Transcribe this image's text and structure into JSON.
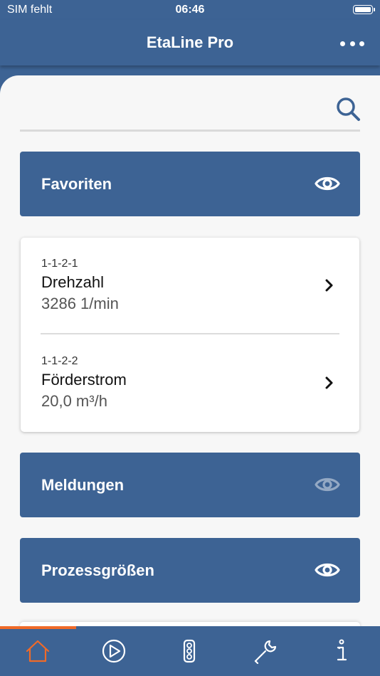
{
  "status_bar": {
    "carrier": "SIM fehlt",
    "time": "06:46",
    "battery_icon": "battery-full-icon"
  },
  "nav": {
    "title": "EtaLine Pro",
    "menu_icon": "more-horizontal-icon"
  },
  "search": {
    "icon": "search-icon"
  },
  "sections": {
    "favorites": {
      "title": "Favoriten",
      "visible": true
    },
    "messages": {
      "title": "Meldungen",
      "visible": false
    },
    "process": {
      "title": "Prozessgrößen",
      "visible": true
    }
  },
  "favorites_items": [
    {
      "id": "1-1-2-1",
      "name": "Drehzahl",
      "value": "3286 1/min"
    },
    {
      "id": "1-1-2-2",
      "name": "Förderstrom",
      "value": "20,0 m³/h"
    }
  ],
  "tabs": [
    {
      "name": "home",
      "icon": "home-icon",
      "active": true
    },
    {
      "name": "play",
      "icon": "play-icon",
      "active": false
    },
    {
      "name": "status",
      "icon": "traffic-light-icon",
      "active": false
    },
    {
      "name": "settings",
      "icon": "wrench-icon",
      "active": false
    },
    {
      "name": "info",
      "icon": "info-icon",
      "active": false
    }
  ],
  "colors": {
    "primary": "#3d6394",
    "background": "#f7f7f7",
    "accent": "#f06a28",
    "icon_default": "#ffffff"
  }
}
